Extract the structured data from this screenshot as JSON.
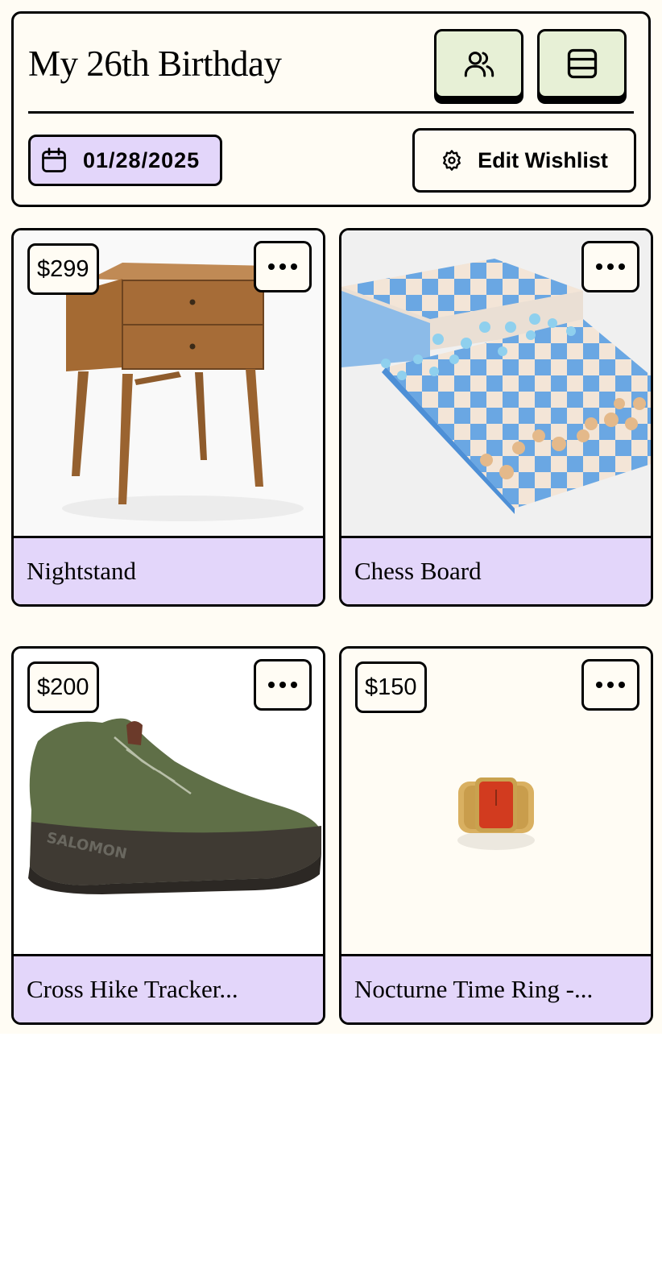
{
  "header": {
    "title": "My 26th Birthday",
    "friends_icon": "users-icon",
    "layout_icon": "rows-layout-icon",
    "date": "01/28/2025",
    "date_icon": "calendar-icon",
    "edit_label": "Edit Wishlist",
    "edit_icon": "gear-icon"
  },
  "colors": {
    "background": "#fffcf4",
    "accent_purple": "#e3d6fa",
    "accent_green": "#e7f0d6",
    "border": "#000000"
  },
  "items": [
    {
      "name": "Nightstand",
      "price": "$299",
      "image": "nightstand"
    },
    {
      "name": "Chess Board",
      "price": "",
      "image": "chess-board"
    },
    {
      "name": "Cross Hike Tracker...",
      "price": "$200",
      "image": "hiking-boot"
    },
    {
      "name": "Nocturne Time Ring -...",
      "price": "$150",
      "image": "watch-ring"
    }
  ]
}
